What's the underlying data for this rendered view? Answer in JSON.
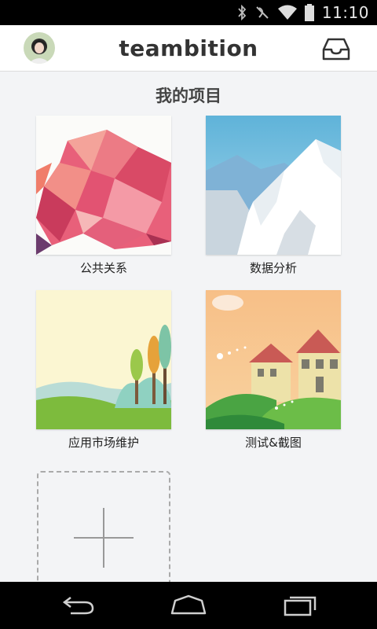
{
  "status_bar": {
    "time": "11:10",
    "icons": [
      "bluetooth-icon",
      "vibrate-icon",
      "wifi-icon",
      "battery-icon"
    ]
  },
  "header": {
    "title": "teambition",
    "avatar_icon": "avatar",
    "inbox_icon": "inbox-icon"
  },
  "main": {
    "section_title": "我的项目",
    "projects": [
      {
        "label": "公共关系"
      },
      {
        "label": "数据分析"
      },
      {
        "label": "应用市场维护"
      },
      {
        "label": "测试&截图"
      }
    ],
    "add_project_icon": "plus-icon"
  },
  "nav_bar": {
    "buttons": [
      "back-icon",
      "home-icon",
      "recent-apps-icon"
    ]
  },
  "colors": {
    "status_bar_bg": "#000000",
    "header_bg": "#ffffff",
    "page_bg": "#f3f4f6",
    "title_text": "#333333"
  }
}
